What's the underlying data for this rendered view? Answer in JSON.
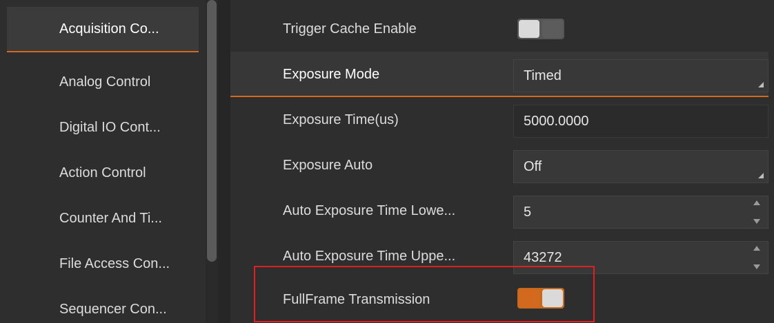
{
  "sidebar": {
    "items": [
      {
        "label": "Acquisition Co..."
      },
      {
        "label": "Analog Control"
      },
      {
        "label": "Digital IO Cont..."
      },
      {
        "label": "Action Control"
      },
      {
        "label": "Counter And Ti..."
      },
      {
        "label": "File Access Con..."
      },
      {
        "label": "Sequencer Con..."
      }
    ]
  },
  "properties": {
    "trigger_cache": {
      "label": "Trigger Cache Enable",
      "state": "off"
    },
    "exposure_mode": {
      "label": "Exposure Mode",
      "value": "Timed"
    },
    "exposure_time": {
      "label": "Exposure Time(us)",
      "value": "5000.0000"
    },
    "exposure_auto": {
      "label": "Exposure Auto",
      "value": "Off"
    },
    "auto_exp_lower": {
      "label": "Auto Exposure Time Lowe...",
      "value": "5"
    },
    "auto_exp_upper": {
      "label": "Auto Exposure Time Uppe...",
      "value": "43272"
    },
    "fullframe": {
      "label": "FullFrame Transmission",
      "state": "on"
    }
  },
  "colors": {
    "accent": "#d2691e",
    "highlight": "#e02020",
    "background": "#2e2e2e"
  }
}
